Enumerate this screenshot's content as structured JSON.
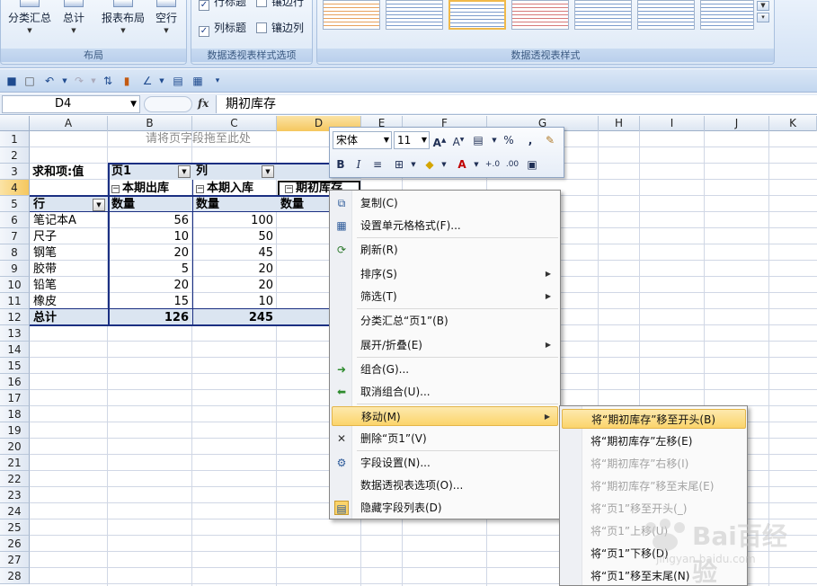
{
  "ribbon": {
    "layout_group": {
      "label": "布局",
      "buttons": [
        "分类汇总",
        "总计",
        "报表布局",
        "空行"
      ]
    },
    "style_options_group": {
      "label": "数据透视表样式选项",
      "options": [
        {
          "label": "行标题",
          "checked": true
        },
        {
          "label": "镶边行",
          "checked": false
        },
        {
          "label": "列标题",
          "checked": true
        },
        {
          "label": "镶边列",
          "checked": false
        }
      ]
    },
    "styles_group": {
      "label": "数据透视表样式"
    }
  },
  "formula_bar": {
    "name_box": "D4",
    "fx": "fx",
    "formula": "期初库存"
  },
  "grid": {
    "columns": [
      "A",
      "B",
      "C",
      "D",
      "E",
      "F",
      "G",
      "H",
      "I",
      "J",
      "K"
    ],
    "rows": [
      "1",
      "2",
      "3",
      "4",
      "5",
      "6",
      "7",
      "8",
      "9",
      "10",
      "11",
      "12",
      "13",
      "14",
      "15",
      "16",
      "17",
      "18",
      "19",
      "20",
      "21",
      "22",
      "23",
      "24",
      "25",
      "26",
      "27",
      "28"
    ],
    "active_col": "D",
    "active_row": "4"
  },
  "pivot": {
    "page_drop_hint": "请将页字段拖至此处",
    "sum_label": "求和项:值",
    "page_field": "页1",
    "col_field": "列",
    "col_items": [
      "本期出库",
      "本期入库",
      "期初库存"
    ],
    "qty_label": "数量",
    "row_field": "行",
    "rows": [
      {
        "name": "笔记本A",
        "out": "56",
        "in": "100"
      },
      {
        "name": "尺子",
        "out": "10",
        "in": "50"
      },
      {
        "name": "钢笔",
        "out": "20",
        "in": "45"
      },
      {
        "name": "胶带",
        "out": "5",
        "in": "20"
      },
      {
        "name": "铅笔",
        "out": "20",
        "in": "20"
      },
      {
        "name": "橡皮",
        "out": "15",
        "in": "10"
      }
    ],
    "total": {
      "name": "总计",
      "out": "126",
      "in": "245"
    }
  },
  "mini_toolbar": {
    "font": "宋体",
    "size": "11",
    "percent": "%",
    "comma": ","
  },
  "context_menu": {
    "items": [
      {
        "label": "复制(C)",
        "icon": "copy-icon"
      },
      {
        "label": "设置单元格格式(F)...",
        "icon": "format-cells-icon"
      },
      {
        "label": "刷新(R)",
        "icon": "refresh-icon"
      },
      {
        "label": "排序(S)",
        "icon": ""
      },
      {
        "label": "筛选(T)",
        "icon": ""
      },
      {
        "label": "分类汇总“页1”(B)",
        "icon": ""
      },
      {
        "label": "展开/折叠(E)",
        "icon": ""
      },
      {
        "label": "组合(G)...",
        "icon": "group-arrow-icon"
      },
      {
        "label": "取消组合(U)...",
        "icon": "ungroup-arrow-icon"
      },
      {
        "label": "移动(M)",
        "icon": ""
      },
      {
        "label": "删除“页1”(V)",
        "icon": "delete-x-icon"
      },
      {
        "label": "字段设置(N)...",
        "icon": "field-settings-icon"
      },
      {
        "label": "数据透视表选项(O)...",
        "icon": ""
      },
      {
        "label": "隐藏字段列表(D)",
        "icon": "field-list-icon"
      }
    ]
  },
  "move_submenu": {
    "items": [
      {
        "label": "将“期初库存”移至开头(B)",
        "disabled": false
      },
      {
        "label": "将“期初库存”左移(E)",
        "disabled": false
      },
      {
        "label": "将“期初库存”右移(I)",
        "disabled": true
      },
      {
        "label": "将“期初库存”移至末尾(E)",
        "disabled": true
      },
      {
        "label": "将“页1”移至开头(_)",
        "disabled": true
      },
      {
        "label": "将“页1”上移(U)",
        "disabled": true
      },
      {
        "label": "将“页1”下移(D)",
        "disabled": false
      },
      {
        "label": "将“页1”移至末尾(N)",
        "disabled": false
      }
    ]
  },
  "watermark": {
    "brand": "Bai百经验",
    "url": "jingyan.baidu.com"
  },
  "colors": {
    "highlight": "#fbd46b",
    "pivot_border": "#1b2f82",
    "pivot_band": "#dbe5f1"
  }
}
